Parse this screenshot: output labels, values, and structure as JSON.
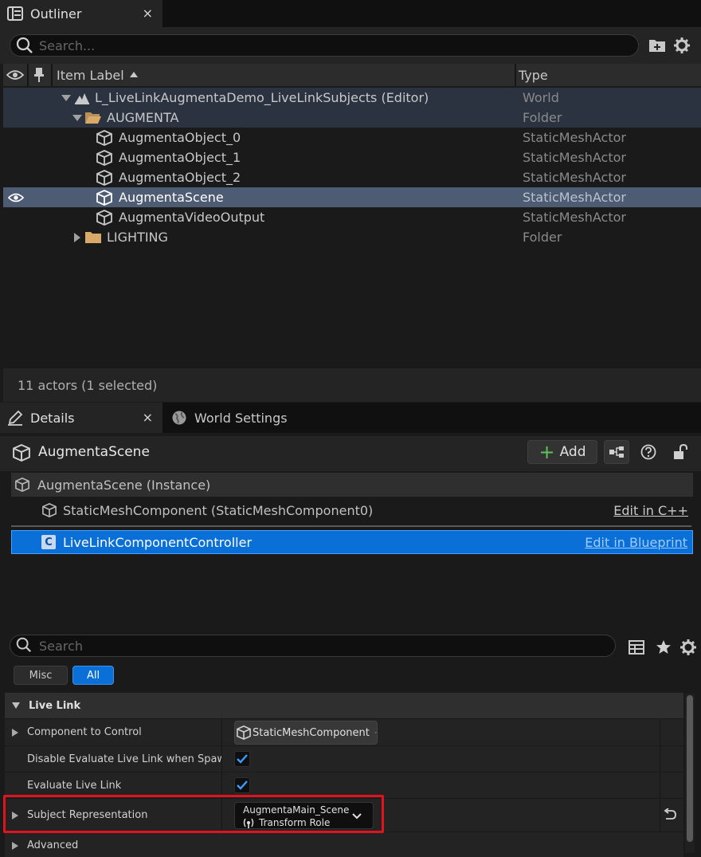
{
  "outliner": {
    "tab_title": "Outliner",
    "close_glyph": "×",
    "search_placeholder": "Search...",
    "columns": {
      "label": "Item Label",
      "type": "Type"
    },
    "rows": [
      {
        "label": "L_LiveLinkAugmentaDemo_LiveLinkSubjects (Editor)",
        "type": "World",
        "icon": "world-icon"
      },
      {
        "label": "AUGMENTA",
        "type": "Folder",
        "icon": "folder-open-icon"
      },
      {
        "label": "AugmentaObject_0",
        "type": "StaticMeshActor",
        "icon": "static-mesh-icon"
      },
      {
        "label": "AugmentaObject_1",
        "type": "StaticMeshActor",
        "icon": "static-mesh-icon"
      },
      {
        "label": "AugmentaObject_2",
        "type": "StaticMeshActor",
        "icon": "static-mesh-icon"
      },
      {
        "label": "AugmentaScene",
        "type": "StaticMeshActor",
        "icon": "static-mesh-icon",
        "selected": true
      },
      {
        "label": "AugmentaVideoOutput",
        "type": "StaticMeshActor",
        "icon": "static-mesh-icon"
      },
      {
        "label": "LIGHTING",
        "type": "Folder",
        "icon": "folder-icon"
      }
    ],
    "status": "11 actors (1 selected)"
  },
  "details": {
    "tab_title": "Details",
    "close_glyph": "×",
    "world_settings_tab": "World Settings",
    "actor_name": "AugmentaScene",
    "add_label": "Add",
    "add_glyph": "+",
    "components": [
      {
        "label": "AugmentaScene (Instance)",
        "link": ""
      },
      {
        "label": "StaticMeshComponent (StaticMeshComponent0)",
        "link": "Edit in C++"
      },
      {
        "label": "LiveLinkComponentController",
        "link": "Edit in Blueprint"
      }
    ],
    "search_placeholder": "Search",
    "filters": {
      "misc": "Misc",
      "all": "All"
    },
    "category": "Live Link",
    "properties": {
      "component_to_control": {
        "name": "Component to Control",
        "value": "StaticMeshComponent"
      },
      "disable_eval": {
        "name": "Disable Evaluate Live Link when Spawna...",
        "checked": true
      },
      "evaluate": {
        "name": "Evaluate Live Link",
        "checked": true
      },
      "subject": {
        "name": "Subject Representation",
        "subject": "AugmentaMain_Scene",
        "role": "Transform Role"
      },
      "advanced": {
        "name": "Advanced"
      }
    }
  },
  "colors": {
    "selection_blue": "#0a70d8",
    "highlight_red": "#e0141e",
    "add_green": "#5cc35c"
  }
}
